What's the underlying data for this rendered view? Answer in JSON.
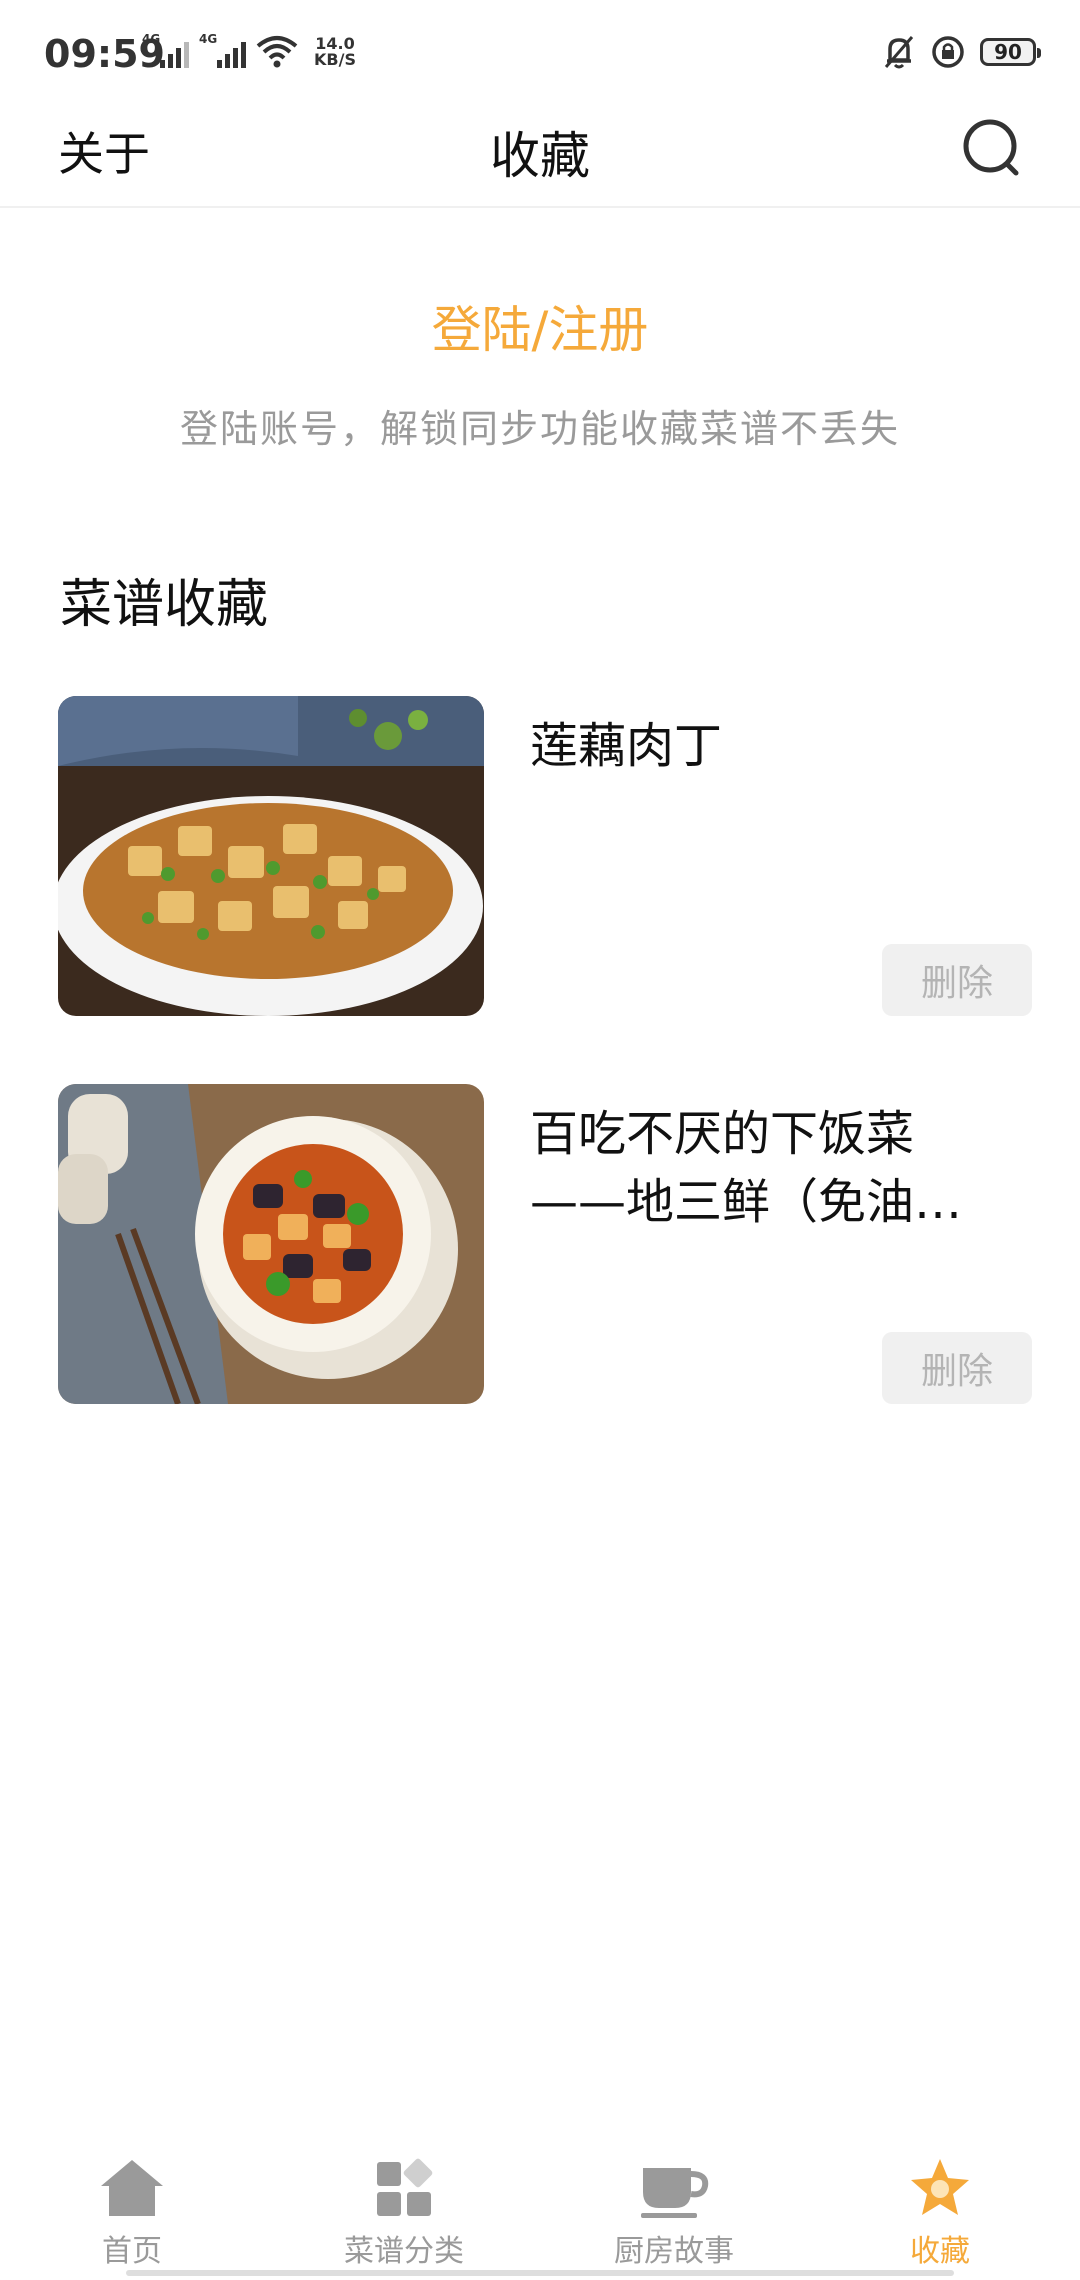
{
  "status_bar": {
    "time": "09:59",
    "network_1": "4G",
    "network_2": "4G",
    "speed_value": "14.0",
    "speed_unit": "KB/S",
    "battery": "90"
  },
  "header": {
    "about": "关于",
    "title": "收藏",
    "search_icon": "search-icon"
  },
  "login": {
    "title": "登陆/注册",
    "subtitle": "登陆账号，解锁同步功能收藏菜谱不丢失"
  },
  "favorites": {
    "section_title": "菜谱收藏",
    "items": [
      {
        "title": "莲藕肉丁",
        "delete_label": "删除"
      },
      {
        "title": "百吃不厌的下饭菜\n——地三鲜（免油…",
        "delete_label": "删除"
      }
    ]
  },
  "bottom_nav": {
    "items": [
      {
        "label": "首页",
        "icon": "home-icon"
      },
      {
        "label": "菜谱分类",
        "icon": "category-icon"
      },
      {
        "label": "厨房故事",
        "icon": "cup-icon"
      },
      {
        "label": "收藏",
        "icon": "star-icon"
      }
    ],
    "active_index": 3
  },
  "colors": {
    "accent": "#f5a93a",
    "muted": "#9a9a9a",
    "delete_bg": "#f0f0f0"
  }
}
